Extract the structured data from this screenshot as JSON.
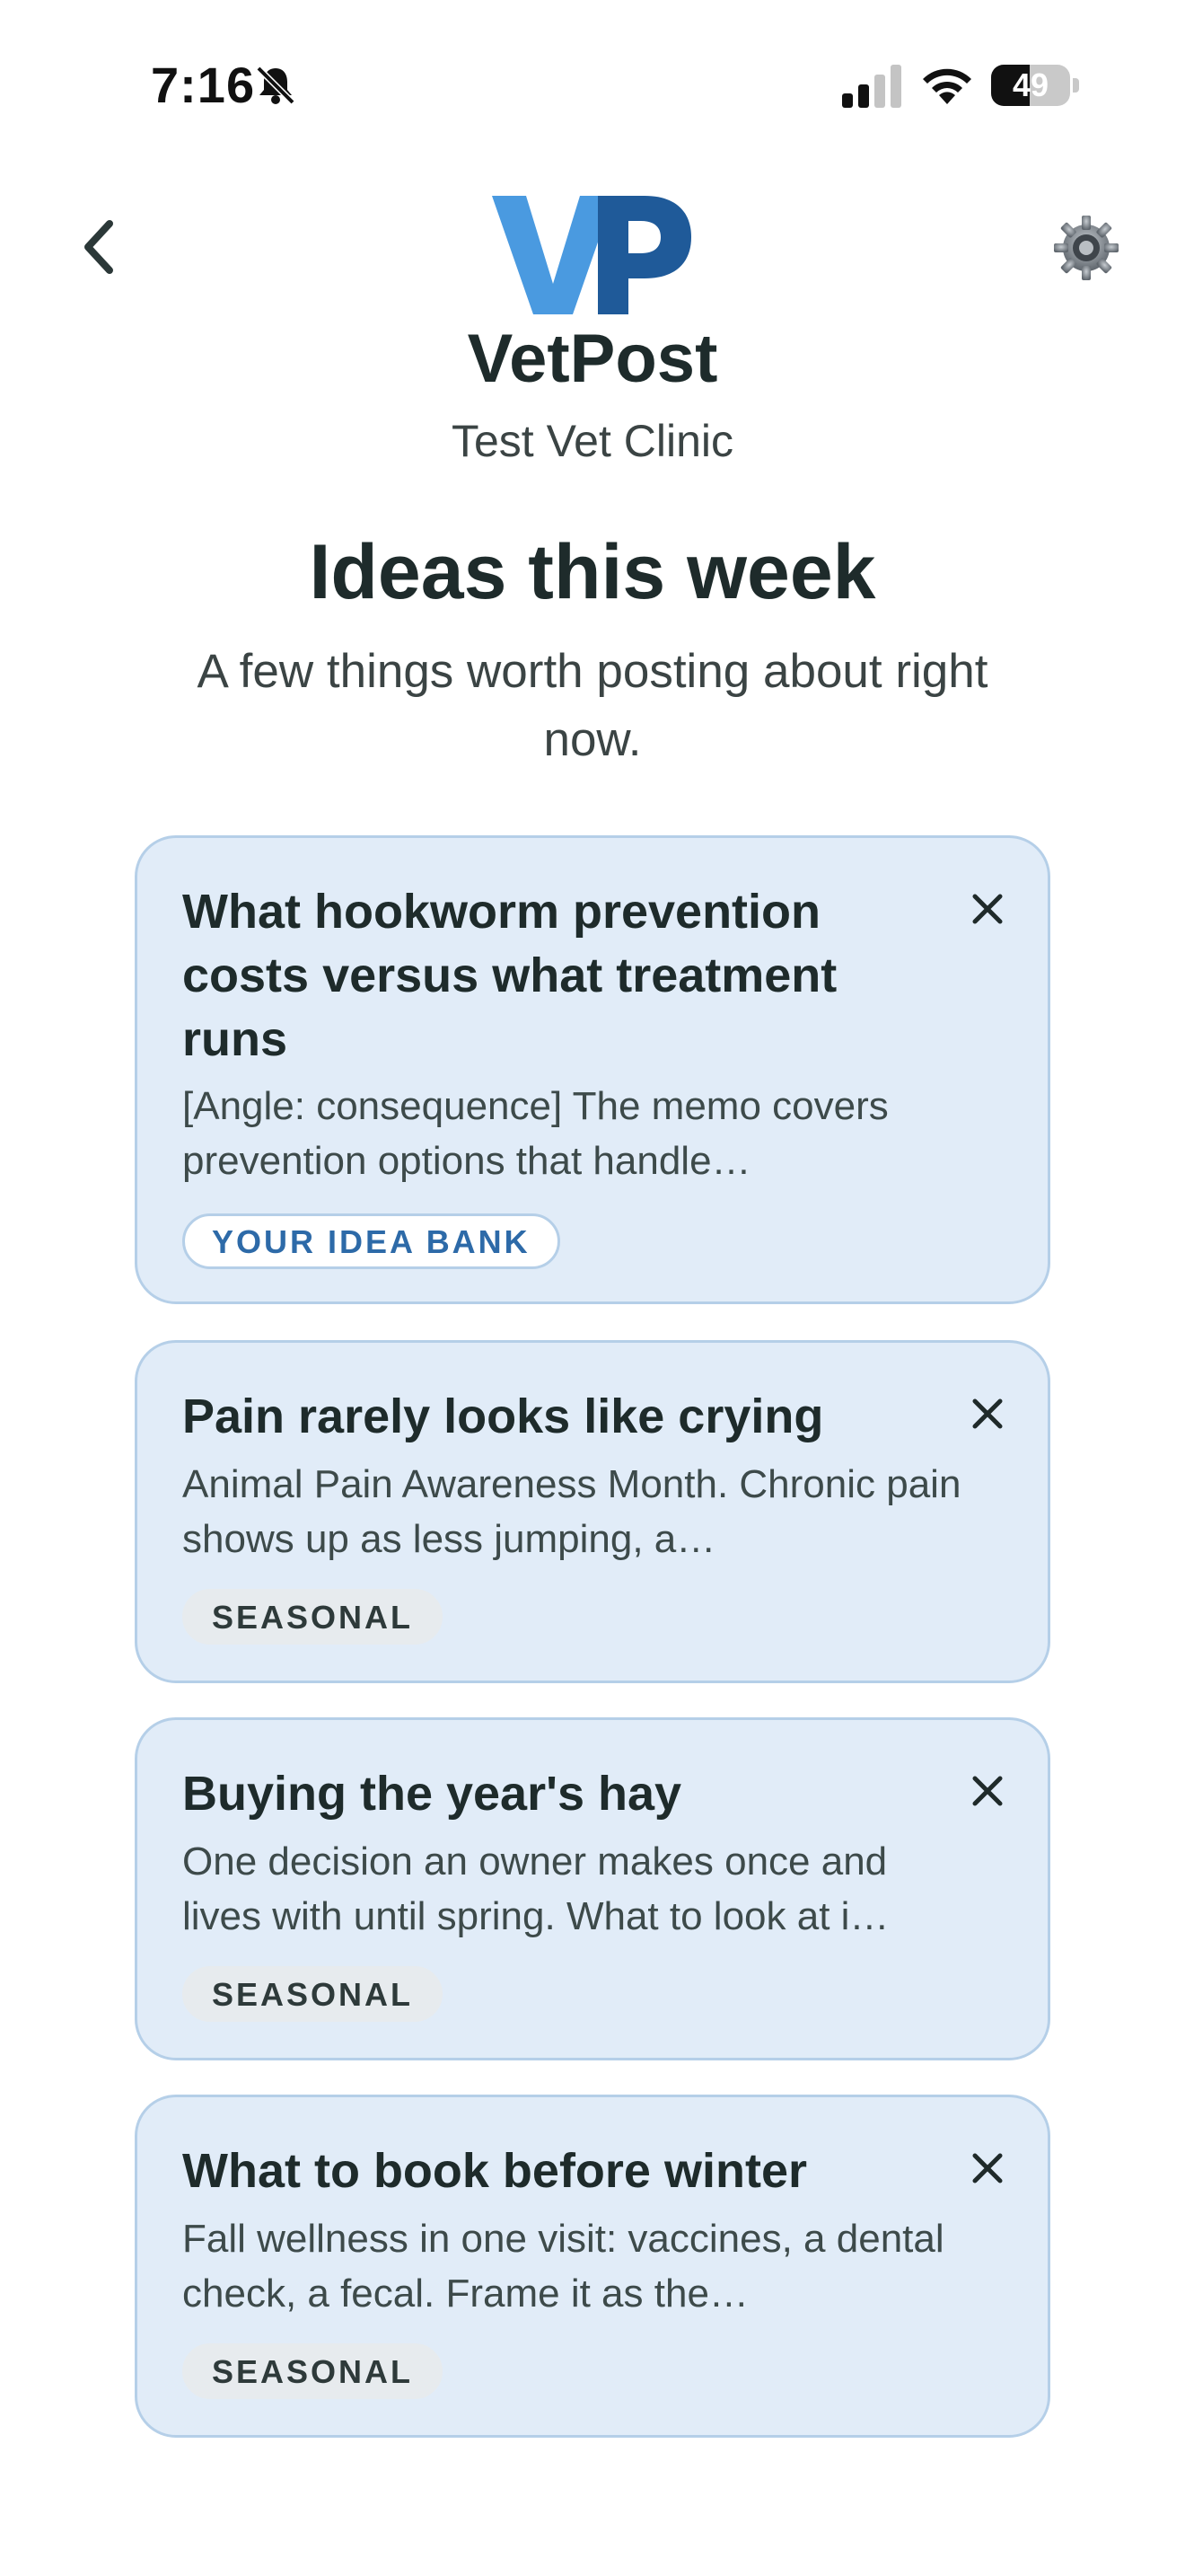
{
  "status_bar": {
    "time": "7:16",
    "battery_percent": 49,
    "battery_label": "49",
    "icons": [
      "bell-slash-icon",
      "cellular-signal-icon",
      "wifi-icon",
      "battery-icon"
    ]
  },
  "header": {
    "logo_text": "VP",
    "logo_colors": {
      "v": "#4a9ae0",
      "p": "#1f5a99"
    },
    "app_name": "VetPost",
    "clinic_name": "Test Vet Clinic",
    "back_icon": "chevron-left-icon",
    "settings_icon": "gear-icon"
  },
  "page": {
    "title": "Ideas this week",
    "subtitle": "A few things worth posting about right now."
  },
  "ideas": [
    {
      "title": "What hookworm prevention costs versus what treatment runs",
      "body": "[Angle: consequence] The memo covers prevention options that handle…",
      "tag": "YOUR IDEA BANK"
    },
    {
      "title": "Pain rarely looks like crying",
      "body": "Animal Pain Awareness Month. Chronic pain shows up as less jumping, a…",
      "tag": "SEASONAL"
    },
    {
      "title": "Buying the year's hay",
      "body": "One decision an owner makes once and lives with until spring. What to look at i…",
      "tag": "SEASONAL"
    },
    {
      "title": "What to book before winter",
      "body": "Fall wellness in one visit: vaccines, a dental check, a fecal. Frame it as the…",
      "tag": "SEASONAL"
    }
  ],
  "colors": {
    "card_bg": "#e1ecf8",
    "card_border": "#b5cfe8",
    "idea_bank_tag_text": "#2d6aa8",
    "seasonal_tag_bg": "#e7ebee"
  }
}
